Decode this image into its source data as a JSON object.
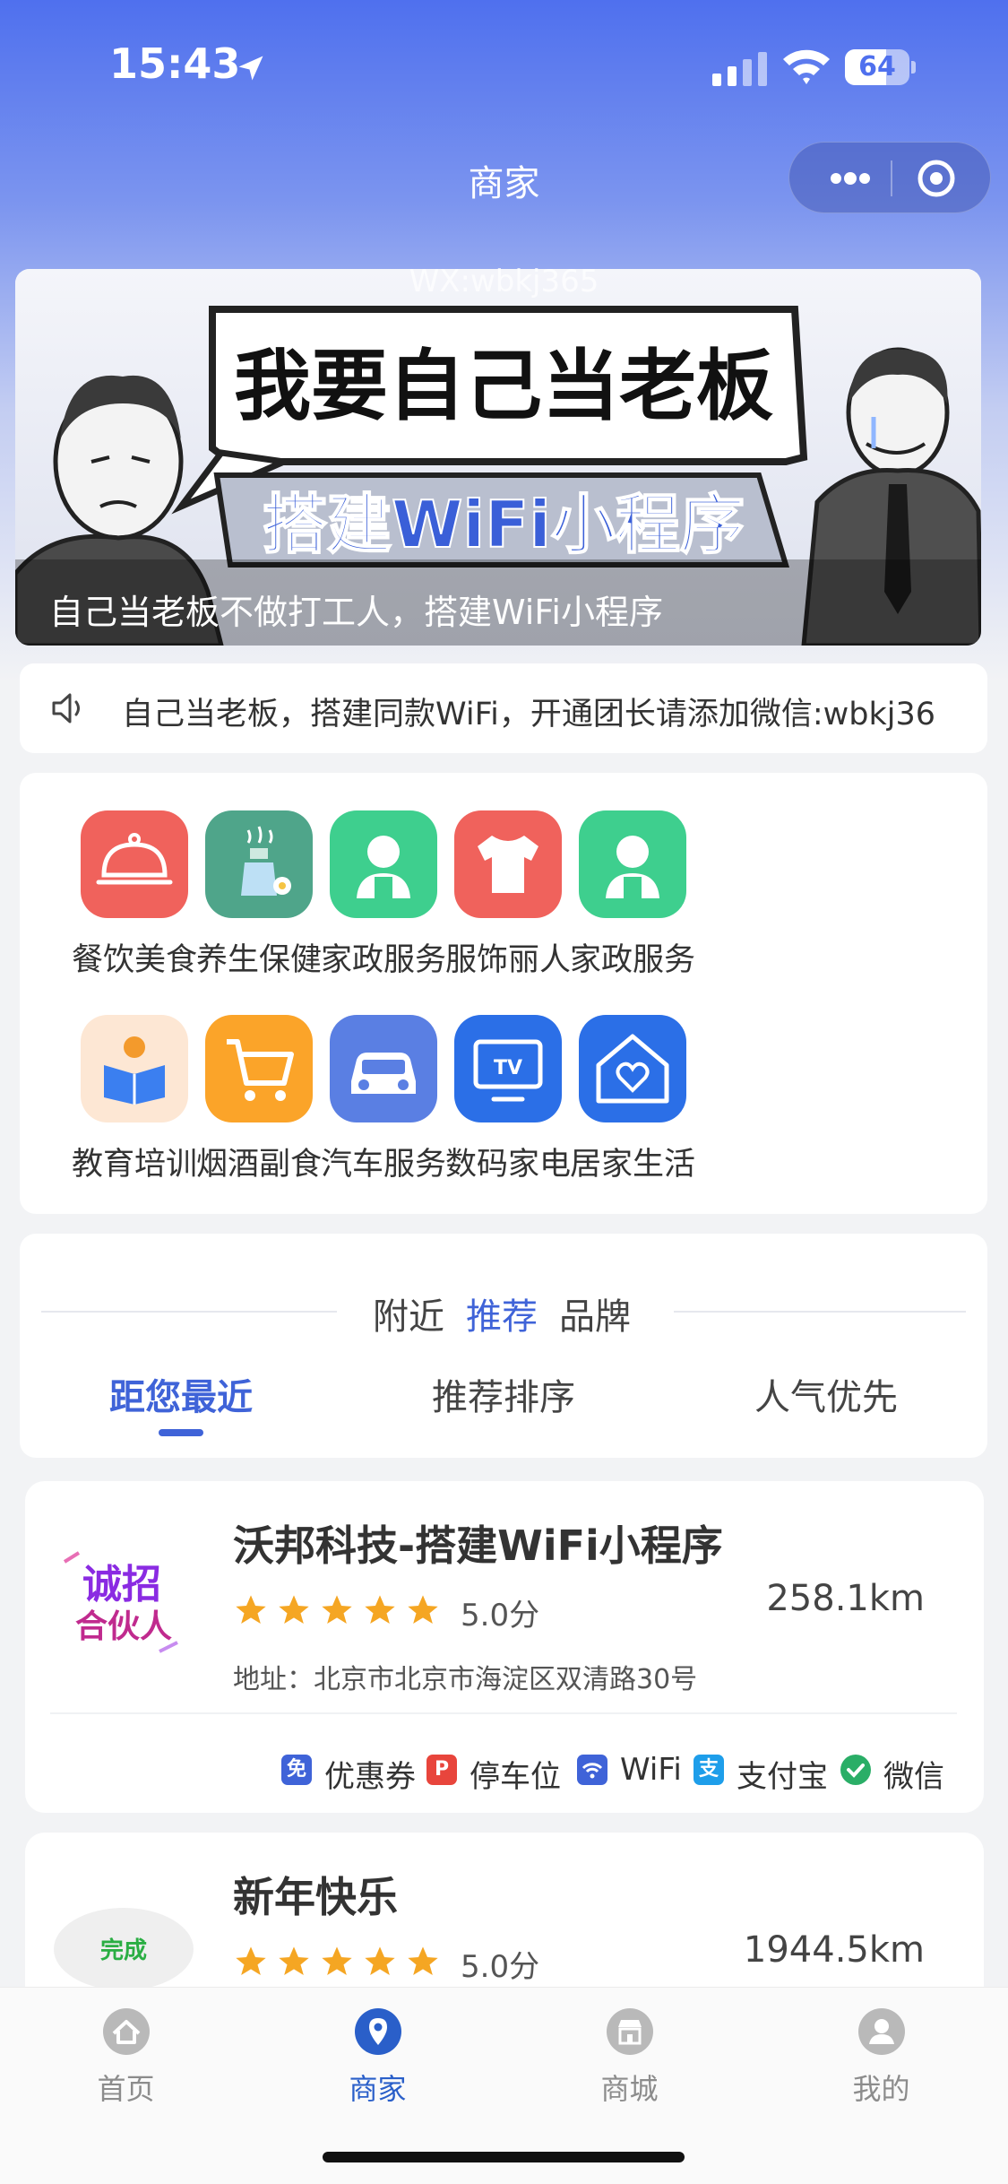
{
  "status_bar": {
    "time": "15:43",
    "battery": "64"
  },
  "nav": {
    "title": "商家"
  },
  "banner": {
    "watermark": "WX:wbkj365",
    "headline": "我要自己当老板",
    "subheadline": "搭建WiFi小程序",
    "caption": "自己当老板不做打工人，搭建WiFi小程序"
  },
  "notice": {
    "text": "自己当老板，搭建同款WiFi，开通团长请添加微信:wbkj36"
  },
  "categories": [
    {
      "label": "餐饮美食",
      "icon": "food-cloche-icon",
      "color": "#f0625c"
    },
    {
      "label": "养生保健",
      "icon": "aroma-bottle-icon",
      "color": "#4fa58a"
    },
    {
      "label": "家政服务",
      "icon": "housekeeper-icon",
      "color": "#3ecf8e"
    },
    {
      "label": "服饰丽人",
      "icon": "tshirt-icon",
      "color": "#f0625c"
    },
    {
      "label": "家政服务",
      "icon": "housekeeper-icon",
      "color": "#3ecf8e"
    },
    {
      "label": "教育培训",
      "icon": "reading-icon",
      "color": "#fde7d4"
    },
    {
      "label": "烟酒副食",
      "icon": "cart-icon",
      "color": "#fba429"
    },
    {
      "label": "汽车服务",
      "icon": "car-icon",
      "color": "#5a7fe3"
    },
    {
      "label": "数码家电",
      "icon": "tv-icon",
      "color": "#2b6fe7"
    },
    {
      "label": "居家生活",
      "icon": "house-heart-icon",
      "color": "#2b6fe7"
    }
  ],
  "top_tabs": [
    {
      "label": "附近",
      "active": false
    },
    {
      "label": "推荐",
      "active": true
    },
    {
      "label": "品牌",
      "active": false
    }
  ],
  "sort_tabs": [
    {
      "label": "距您最近",
      "active": true
    },
    {
      "label": "推荐排序",
      "active": false
    },
    {
      "label": "人气优先",
      "active": false
    }
  ],
  "merchants": [
    {
      "name": "沃邦科技-搭建WiFi小程序",
      "rating": "5.0分",
      "stars": 5,
      "distance": "258.1km",
      "address": "地址：北京市北京市海淀区双清路30号",
      "logo_text": [
        "诚招",
        "合伙人"
      ],
      "tags": [
        {
          "icon_text": "免",
          "label": "优惠券",
          "color": "#3f63d8"
        },
        {
          "icon_text": "P",
          "label": "停车位",
          "color": "#e8453c"
        },
        {
          "icon_text": "",
          "label": "WiFi",
          "color": "#3f63d8"
        },
        {
          "icon_text": "支",
          "label": "支付宝",
          "color": "#1e9eea"
        },
        {
          "icon_text": "",
          "label": "微信",
          "color": "#2aae67"
        }
      ]
    },
    {
      "name": "新年快乐",
      "rating": "5.0分",
      "stars": 5,
      "distance": "1944.5km",
      "logo_text": [
        "完成"
      ]
    }
  ],
  "tabbar": [
    {
      "label": "首页",
      "icon": "home-icon",
      "active": false
    },
    {
      "label": "商家",
      "icon": "location-pin-icon",
      "active": true
    },
    {
      "label": "商城",
      "icon": "shop-icon",
      "active": false
    },
    {
      "label": "我的",
      "icon": "profile-icon",
      "active": false
    }
  ]
}
